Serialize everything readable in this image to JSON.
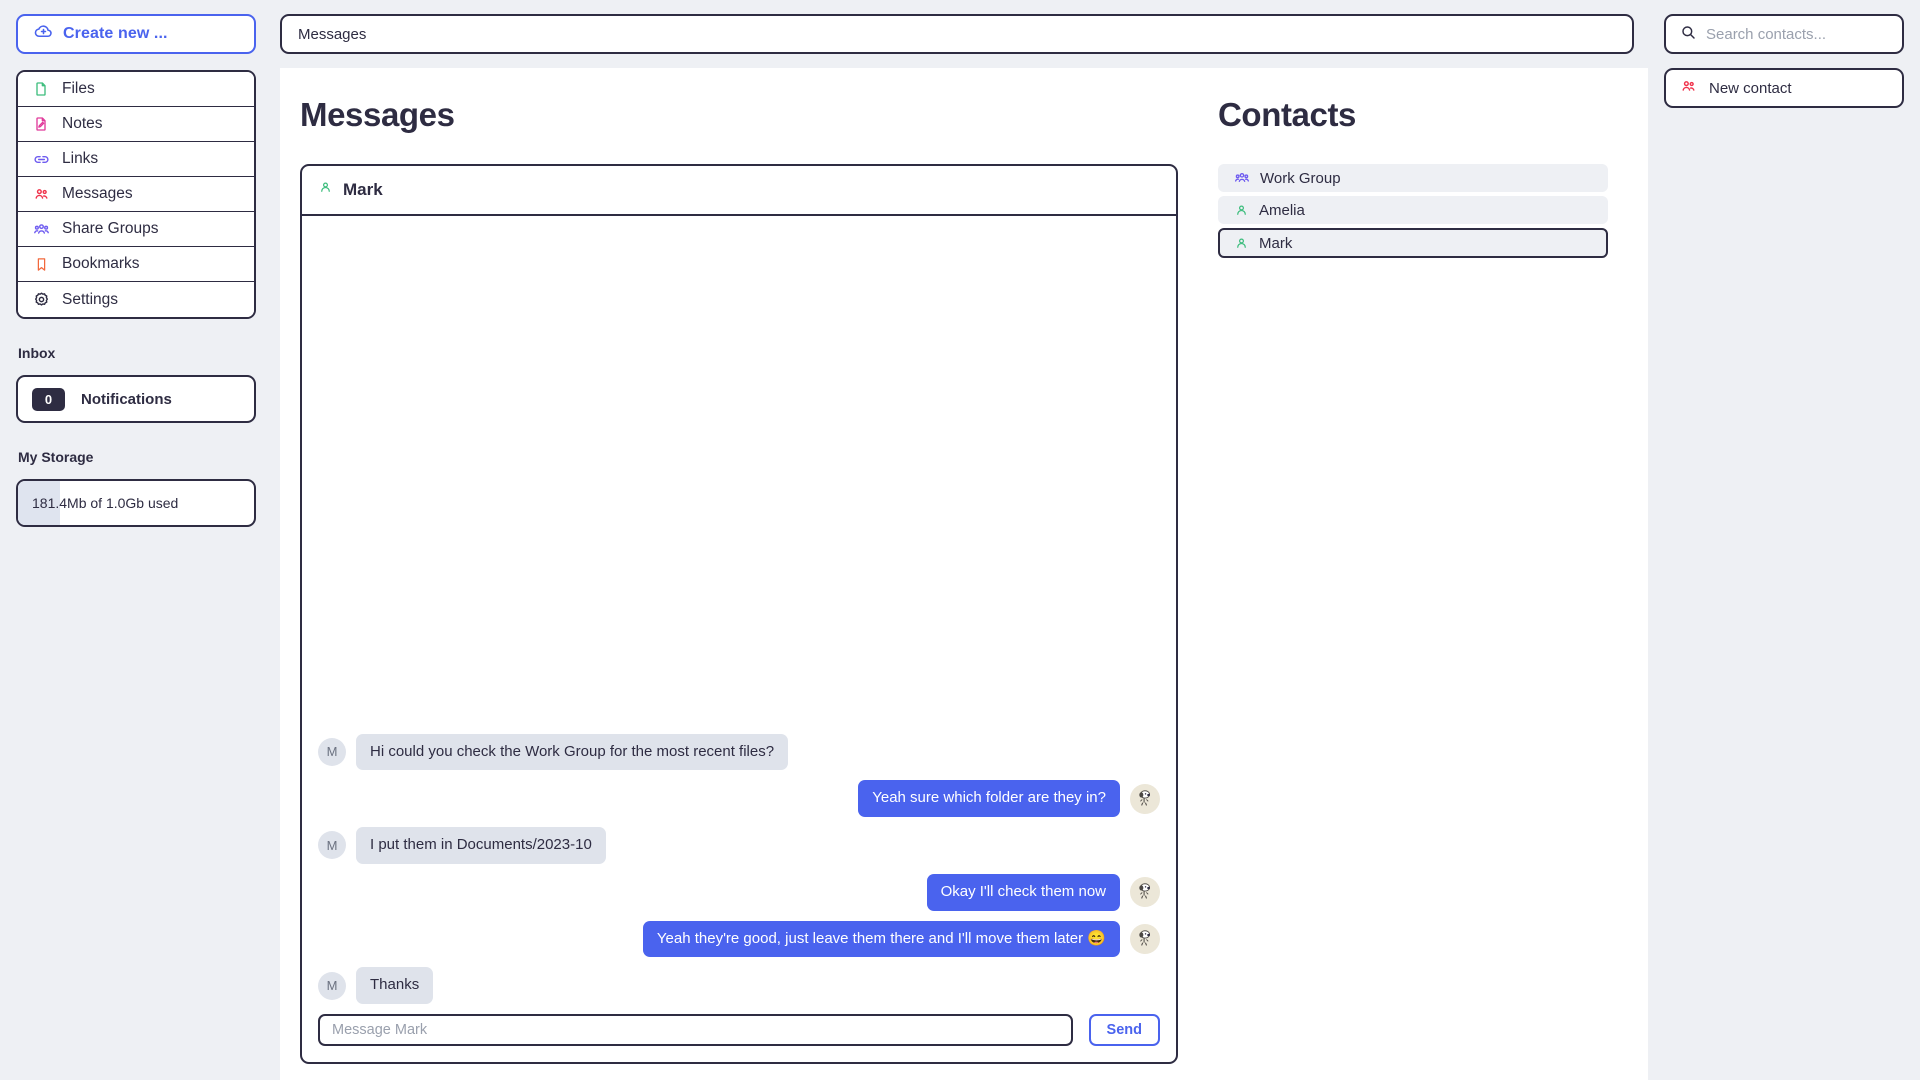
{
  "theme": {
    "accent_blue": "#4a63ee",
    "ink": "#2e2c42",
    "page_bg": "#eef0f4",
    "bubble_in_bg": "#dfe3eb",
    "bubble_out_bg": "#4a63ee"
  },
  "sidebar": {
    "create_button": {
      "label": "Create new ...",
      "icon": "cloud-upload-icon"
    },
    "nav_items": [
      {
        "label": "Files",
        "icon": "file-icon",
        "color": "#3dbd7d"
      },
      {
        "label": "Notes",
        "icon": "note-pencil-icon",
        "color": "#e0399a"
      },
      {
        "label": "Links",
        "icon": "link-icon",
        "color": "#6f5cf0"
      },
      {
        "label": "Messages",
        "icon": "people-icon",
        "color": "#f0324b"
      },
      {
        "label": "Share Groups",
        "icon": "group-icon",
        "color": "#6f5cf0"
      },
      {
        "label": "Bookmarks",
        "icon": "bookmark-icon",
        "color": "#f2683c"
      },
      {
        "label": "Settings",
        "icon": "gear-icon",
        "color": "#2e2c42"
      }
    ],
    "inbox": {
      "section_label": "Inbox",
      "notifications_count": "0",
      "notifications_label": "Notifications"
    },
    "storage": {
      "section_label": "My Storage",
      "usage_text": "181.4Mb of 1.0Gb used",
      "used_percent": 17.7
    }
  },
  "topbar": {
    "path_value": "Messages",
    "path_placeholder": "Messages"
  },
  "main": {
    "title": "Messages",
    "chat": {
      "header_name": "Mark",
      "header_icon": "person-icon",
      "messages": [
        {
          "direction": "in",
          "avatar": "M",
          "text": "Hi could you check the Work Group for the most recent files?"
        },
        {
          "direction": "out",
          "avatar": "snoopy-avatar-icon",
          "text": "Yeah sure which folder are they in?"
        },
        {
          "direction": "in",
          "avatar": "M",
          "text": "I put them in Documents/2023-10"
        },
        {
          "direction": "out",
          "avatar": "snoopy-avatar-icon",
          "text": "Okay I'll check them now"
        },
        {
          "direction": "out",
          "avatar": "snoopy-avatar-icon",
          "text": "Yeah they're good, just leave them there and I'll move them later 😄"
        },
        {
          "direction": "in",
          "avatar": "M",
          "text": "Thanks"
        }
      ],
      "composer": {
        "input_value": "",
        "input_placeholder": "Message Mark",
        "send_label": "Send"
      }
    }
  },
  "contacts": {
    "title": "Contacts",
    "items": [
      {
        "label": "Work Group",
        "icon": "group-icon",
        "color": "#6f5cf0",
        "selected": false
      },
      {
        "label": "Amelia",
        "icon": "person-icon",
        "color": "#3dbd7d",
        "selected": false
      },
      {
        "label": "Mark",
        "icon": "person-icon",
        "color": "#3dbd7d",
        "selected": true
      }
    ]
  },
  "right_rail": {
    "search": {
      "placeholder": "Search contacts...",
      "value": "",
      "icon": "search-icon"
    },
    "new_contact": {
      "label": "New contact",
      "icon": "people-icon"
    }
  }
}
